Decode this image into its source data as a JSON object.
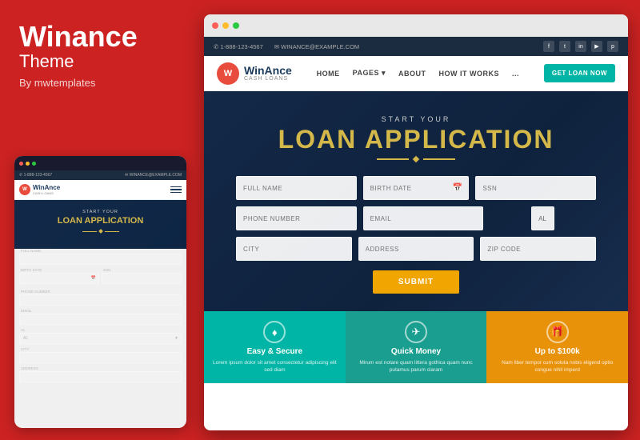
{
  "left": {
    "brand_name": "Winance",
    "brand_sub": "Theme",
    "brand_by": "By mwtemplates"
  },
  "topbar": {
    "phone": "1-888-123-4567",
    "email": "WINANCE@EXAMPLE.COM",
    "social": [
      "f",
      "t",
      "in",
      "▶",
      "𝓟"
    ]
  },
  "nav": {
    "logo_letter": "W",
    "logo_name": "WinAnce",
    "logo_tagline": "CASH LOANS",
    "links": [
      "HOME",
      "PAGES",
      "ABOUT",
      "HOW IT WORKS",
      "..."
    ],
    "cta": "GET LOAN NOW"
  },
  "hero": {
    "pretitle": "START YOUR",
    "title": "LOAN APPLICATION"
  },
  "form": {
    "fields": {
      "full_name": "FULL NAME",
      "birth_date": "BIRTH DATE",
      "ssn": "SSN",
      "phone": "PHONE NUMBER",
      "email": "EMAIL",
      "state": "AL",
      "city": "CITY",
      "address": "ADDRESS",
      "zip": "ZIP CODE"
    },
    "submit": "SUBMIT"
  },
  "features": [
    {
      "icon": "♦",
      "title": "Easy & Secure",
      "text": "Lorem ipsum dolor sit amet consectetur adipiscing elit sed diam"
    },
    {
      "icon": "✈",
      "title": "Quick Money",
      "text": "Mirum est notare quam littera gothica quam nunc putamus parum claram"
    },
    {
      "icon": "🎁",
      "title": "Up to $100k",
      "text": "Nam liber tempor cum soluta nobis eligend optio congue nihil imperd"
    }
  ],
  "mobile": {
    "hero_pretitle": "START YOUR",
    "hero_title": "LOAN APPLICATION",
    "fields": [
      "FULL NAME",
      "BIRTH DATE",
      "SSN",
      "PHONE NUMBER",
      "EMAIL",
      "AL",
      "CITY",
      "ADDRESS"
    ]
  }
}
